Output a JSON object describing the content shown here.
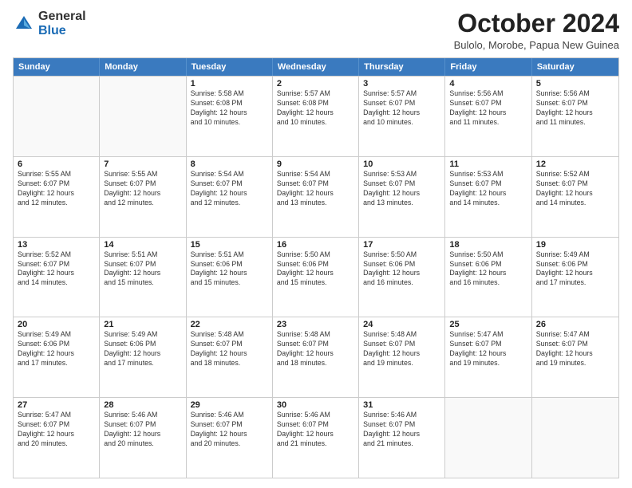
{
  "logo": {
    "general": "General",
    "blue": "Blue"
  },
  "title": "October 2024",
  "location": "Bulolo, Morobe, Papua New Guinea",
  "days": [
    "Sunday",
    "Monday",
    "Tuesday",
    "Wednesday",
    "Thursday",
    "Friday",
    "Saturday"
  ],
  "rows": [
    [
      {
        "num": "",
        "lines": []
      },
      {
        "num": "",
        "lines": []
      },
      {
        "num": "1",
        "lines": [
          "Sunrise: 5:58 AM",
          "Sunset: 6:08 PM",
          "Daylight: 12 hours",
          "and 10 minutes."
        ]
      },
      {
        "num": "2",
        "lines": [
          "Sunrise: 5:57 AM",
          "Sunset: 6:08 PM",
          "Daylight: 12 hours",
          "and 10 minutes."
        ]
      },
      {
        "num": "3",
        "lines": [
          "Sunrise: 5:57 AM",
          "Sunset: 6:07 PM",
          "Daylight: 12 hours",
          "and 10 minutes."
        ]
      },
      {
        "num": "4",
        "lines": [
          "Sunrise: 5:56 AM",
          "Sunset: 6:07 PM",
          "Daylight: 12 hours",
          "and 11 minutes."
        ]
      },
      {
        "num": "5",
        "lines": [
          "Sunrise: 5:56 AM",
          "Sunset: 6:07 PM",
          "Daylight: 12 hours",
          "and 11 minutes."
        ]
      }
    ],
    [
      {
        "num": "6",
        "lines": [
          "Sunrise: 5:55 AM",
          "Sunset: 6:07 PM",
          "Daylight: 12 hours",
          "and 12 minutes."
        ]
      },
      {
        "num": "7",
        "lines": [
          "Sunrise: 5:55 AM",
          "Sunset: 6:07 PM",
          "Daylight: 12 hours",
          "and 12 minutes."
        ]
      },
      {
        "num": "8",
        "lines": [
          "Sunrise: 5:54 AM",
          "Sunset: 6:07 PM",
          "Daylight: 12 hours",
          "and 12 minutes."
        ]
      },
      {
        "num": "9",
        "lines": [
          "Sunrise: 5:54 AM",
          "Sunset: 6:07 PM",
          "Daylight: 12 hours",
          "and 13 minutes."
        ]
      },
      {
        "num": "10",
        "lines": [
          "Sunrise: 5:53 AM",
          "Sunset: 6:07 PM",
          "Daylight: 12 hours",
          "and 13 minutes."
        ]
      },
      {
        "num": "11",
        "lines": [
          "Sunrise: 5:53 AM",
          "Sunset: 6:07 PM",
          "Daylight: 12 hours",
          "and 14 minutes."
        ]
      },
      {
        "num": "12",
        "lines": [
          "Sunrise: 5:52 AM",
          "Sunset: 6:07 PM",
          "Daylight: 12 hours",
          "and 14 minutes."
        ]
      }
    ],
    [
      {
        "num": "13",
        "lines": [
          "Sunrise: 5:52 AM",
          "Sunset: 6:07 PM",
          "Daylight: 12 hours",
          "and 14 minutes."
        ]
      },
      {
        "num": "14",
        "lines": [
          "Sunrise: 5:51 AM",
          "Sunset: 6:07 PM",
          "Daylight: 12 hours",
          "and 15 minutes."
        ]
      },
      {
        "num": "15",
        "lines": [
          "Sunrise: 5:51 AM",
          "Sunset: 6:06 PM",
          "Daylight: 12 hours",
          "and 15 minutes."
        ]
      },
      {
        "num": "16",
        "lines": [
          "Sunrise: 5:50 AM",
          "Sunset: 6:06 PM",
          "Daylight: 12 hours",
          "and 15 minutes."
        ]
      },
      {
        "num": "17",
        "lines": [
          "Sunrise: 5:50 AM",
          "Sunset: 6:06 PM",
          "Daylight: 12 hours",
          "and 16 minutes."
        ]
      },
      {
        "num": "18",
        "lines": [
          "Sunrise: 5:50 AM",
          "Sunset: 6:06 PM",
          "Daylight: 12 hours",
          "and 16 minutes."
        ]
      },
      {
        "num": "19",
        "lines": [
          "Sunrise: 5:49 AM",
          "Sunset: 6:06 PM",
          "Daylight: 12 hours",
          "and 17 minutes."
        ]
      }
    ],
    [
      {
        "num": "20",
        "lines": [
          "Sunrise: 5:49 AM",
          "Sunset: 6:06 PM",
          "Daylight: 12 hours",
          "and 17 minutes."
        ]
      },
      {
        "num": "21",
        "lines": [
          "Sunrise: 5:49 AM",
          "Sunset: 6:06 PM",
          "Daylight: 12 hours",
          "and 17 minutes."
        ]
      },
      {
        "num": "22",
        "lines": [
          "Sunrise: 5:48 AM",
          "Sunset: 6:07 PM",
          "Daylight: 12 hours",
          "and 18 minutes."
        ]
      },
      {
        "num": "23",
        "lines": [
          "Sunrise: 5:48 AM",
          "Sunset: 6:07 PM",
          "Daylight: 12 hours",
          "and 18 minutes."
        ]
      },
      {
        "num": "24",
        "lines": [
          "Sunrise: 5:48 AM",
          "Sunset: 6:07 PM",
          "Daylight: 12 hours",
          "and 19 minutes."
        ]
      },
      {
        "num": "25",
        "lines": [
          "Sunrise: 5:47 AM",
          "Sunset: 6:07 PM",
          "Daylight: 12 hours",
          "and 19 minutes."
        ]
      },
      {
        "num": "26",
        "lines": [
          "Sunrise: 5:47 AM",
          "Sunset: 6:07 PM",
          "Daylight: 12 hours",
          "and 19 minutes."
        ]
      }
    ],
    [
      {
        "num": "27",
        "lines": [
          "Sunrise: 5:47 AM",
          "Sunset: 6:07 PM",
          "Daylight: 12 hours",
          "and 20 minutes."
        ]
      },
      {
        "num": "28",
        "lines": [
          "Sunrise: 5:46 AM",
          "Sunset: 6:07 PM",
          "Daylight: 12 hours",
          "and 20 minutes."
        ]
      },
      {
        "num": "29",
        "lines": [
          "Sunrise: 5:46 AM",
          "Sunset: 6:07 PM",
          "Daylight: 12 hours",
          "and 20 minutes."
        ]
      },
      {
        "num": "30",
        "lines": [
          "Sunrise: 5:46 AM",
          "Sunset: 6:07 PM",
          "Daylight: 12 hours",
          "and 21 minutes."
        ]
      },
      {
        "num": "31",
        "lines": [
          "Sunrise: 5:46 AM",
          "Sunset: 6:07 PM",
          "Daylight: 12 hours",
          "and 21 minutes."
        ]
      },
      {
        "num": "",
        "lines": []
      },
      {
        "num": "",
        "lines": []
      }
    ]
  ]
}
